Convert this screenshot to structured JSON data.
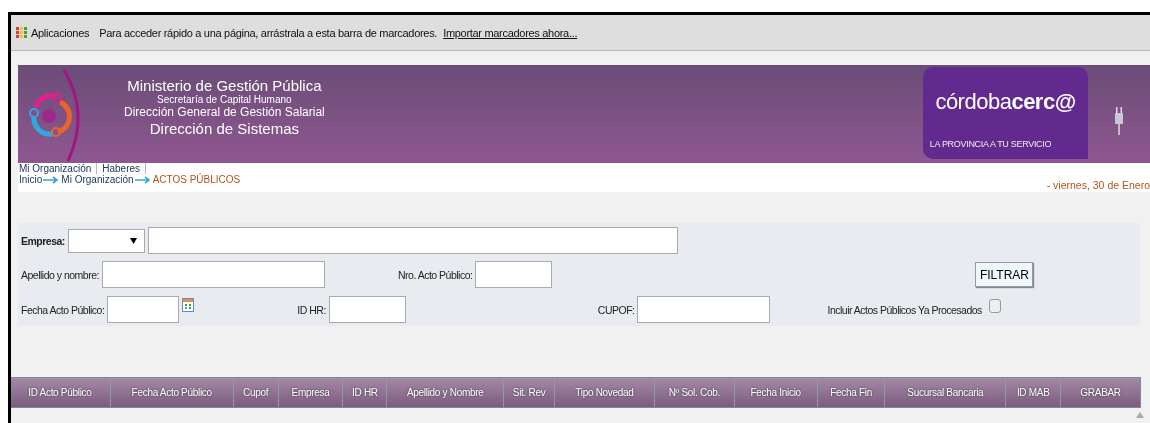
{
  "bookmarks_bar": {
    "apps_label": "Aplicaciones",
    "hint": "Para acceder rápido a una página, arrástrala a esta barra de marcadores.",
    "import_link": "Importar marcadores ahora..."
  },
  "header": {
    "title_lines": [
      {
        "text": "Ministerio de Gestión Pública",
        "kind": "main"
      },
      {
        "text": "Secretaría de Capital Humano",
        "kind": "small"
      },
      {
        "text": "Dirección General de Gestión Salarial",
        "kind": "mid"
      },
      {
        "text": "Dirección de Sistemas",
        "kind": "main"
      }
    ],
    "brand": "córdoba**cerc@**",
    "brand_tagline": "LA PROVINCIA A TU SERVICIO"
  },
  "menu": [
    "Mi Organización",
    "Haberes"
  ],
  "breadcrumb": [
    {
      "label": "Inicio",
      "current": false
    },
    {
      "label": "Mi Organización",
      "current": false
    },
    {
      "label": "ACTOS PÚBLICOS",
      "current": true
    }
  ],
  "date": "- viernes, 30 de Enero",
  "filters": {
    "empresa_label": "Empresa:",
    "apellido_label": "Apellido y nombre:",
    "nro_label": "Nro. Acto Público:",
    "filter_button": "FILTRAR",
    "fecha_label": "Fecha Acto Público:",
    "idhr_label": "ID HR:",
    "cupof_label": "CUPOF:",
    "include_label": "Incluir Actos Públicos Ya Procesados",
    "include_checked": false
  },
  "table": {
    "columns": [
      "ID Acto Público",
      "Fecha Acto Público",
      "Cupof",
      "Empresa",
      "ID HR",
      "Apellido y Nombre",
      "Sit. Rev",
      "Tipo Novedad",
      "Nº Sol. Cob.",
      "Fecha Inicio",
      "Fecha Fin",
      "Sucursal Bancaria",
      "ID MAB",
      "GRABAR"
    ]
  }
}
